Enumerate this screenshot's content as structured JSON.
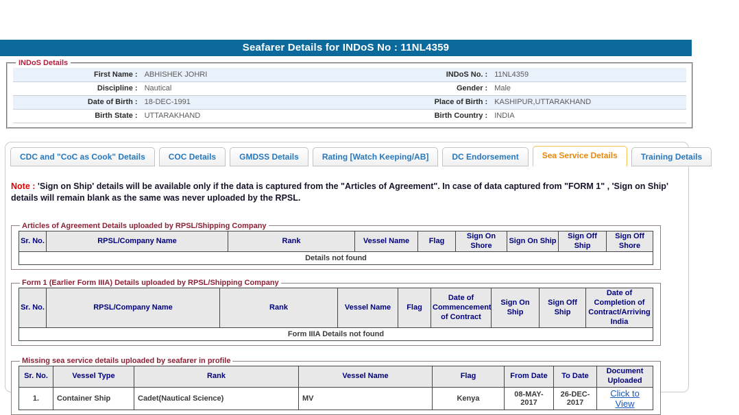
{
  "page": {
    "title": "Seafarer Details for INDoS No : 11NL4359"
  },
  "colors": {
    "titlebar_bg": "#0B6A9B",
    "active_tab": "#E8890C",
    "tab_blue": "#2778BE",
    "note_red": "#E00000",
    "table_header_text": "#00007D",
    "legend_red": "#B11E3C",
    "link_blue": "#1558C0",
    "alt_row_bg": "#E9F1FB"
  },
  "indos": {
    "legend": "INDoS Details",
    "rows": [
      {
        "l1": "First Name :",
        "v1": "ABHISHEK JOHRI",
        "l2": "INDoS No. :",
        "v2": "11NL4359"
      },
      {
        "l1": "Discipline :",
        "v1": "Nautical",
        "l2": "Gender :",
        "v2": "Male"
      },
      {
        "l1": "Date of Birth :",
        "v1": "18-DEC-1991",
        "l2": "Place of Birth :",
        "v2": "KASHIPUR,UTTARAKHAND"
      },
      {
        "l1": "Birth State :",
        "v1": "UTTARAKHAND",
        "l2": "Birth Country :",
        "v2": "INDIA"
      }
    ]
  },
  "tabs": [
    {
      "label": "CDC and \"CoC as Cook\" Details",
      "active": false
    },
    {
      "label": "COC Details",
      "active": false
    },
    {
      "label": "GMDSS Details",
      "active": false
    },
    {
      "label": "Rating [Watch Keeping/AB]",
      "active": false
    },
    {
      "label": "DC Endorsement",
      "active": false
    },
    {
      "label": "Sea Service Details",
      "active": true
    },
    {
      "label": "Training Details",
      "active": false
    }
  ],
  "note": {
    "prefix": "Note :",
    "text": "'Sign on Ship' details will be available only if the data is captured from the \"Articles of Agreement\". In case of data captured from \"FORM 1\" , 'Sign on Ship' details will remain blank as the same was never uploaded by the RPSL."
  },
  "sections": [
    {
      "legend": "Articles of Agreement Details uploaded by RPSL/Shipping Company",
      "headers": [
        "Sr. No.",
        "RPSL/Company Name",
        "Rank",
        "Vessel Name",
        "Flag",
        "Sign On Shore",
        "Sign On Ship",
        "Sign Off Ship",
        "Sign Off Shore"
      ],
      "empty_text": "Details not found"
    },
    {
      "legend": "Form 1 (Earlier Form IIIA) Details uploaded by RPSL/Shipping Company",
      "headers": [
        "Sr. No.",
        "RPSL/Company Name",
        "Rank",
        "Vessel Name",
        "Flag",
        "Date of Commencement of Contract",
        "Sign On Ship",
        "Sign Off Ship",
        "Date of Completion of Contract/Arriving India"
      ],
      "empty_text": "Form IIIA Details not found"
    },
    {
      "legend": "Missing sea service details uploaded by seafarer in profile",
      "headers": [
        "Sr. No.",
        "Vessel Type",
        "Rank",
        "Vessel Name",
        "Flag",
        "From Date",
        "To Date",
        "Document Uploaded"
      ],
      "row": {
        "sr": "1.",
        "vessel_type": "Container Ship",
        "rank": "Cadet(Nautical Science)",
        "vessel_name": "MV",
        "flag": "Kenya",
        "from_date": "08-MAY-2017",
        "to_date": "26-DEC-2017",
        "document_link": "Click to View"
      }
    }
  ]
}
